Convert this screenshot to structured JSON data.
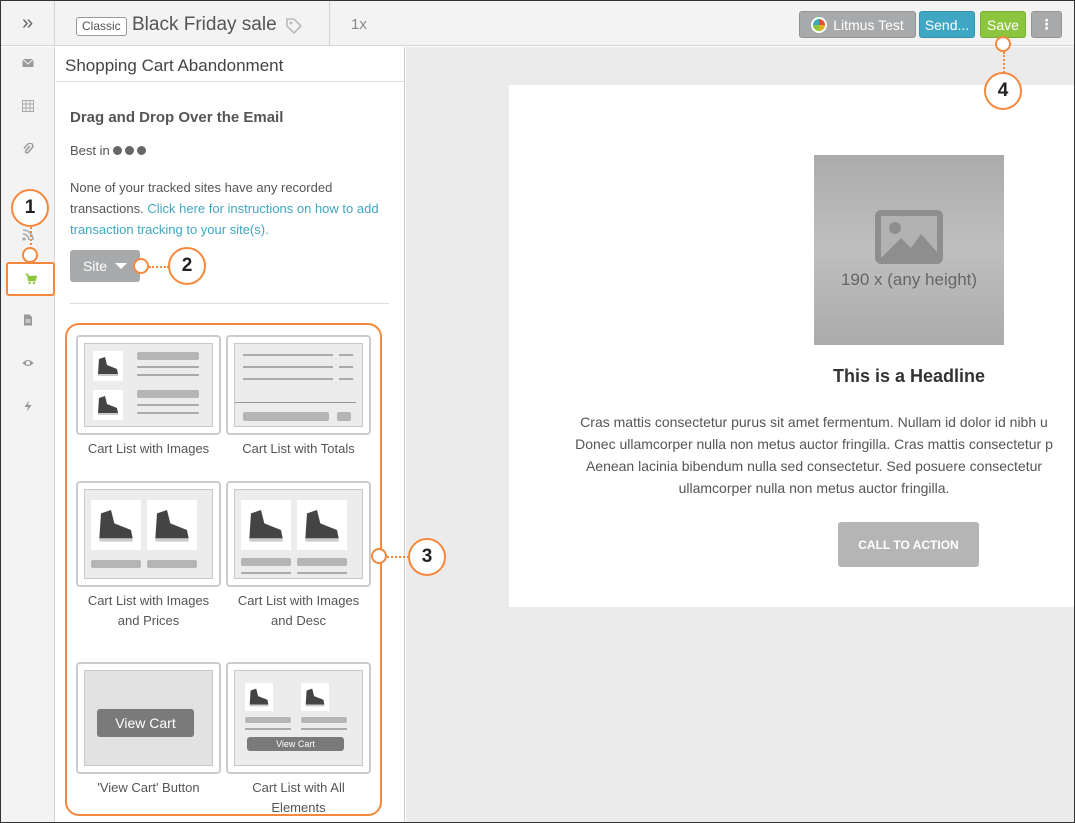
{
  "topbar": {
    "collapse_glyph": "»",
    "badge": "Classic",
    "title": "Black Friday sale",
    "zoom": "1x",
    "buttons": {
      "litmus": "Litmus Test",
      "send": "Send...",
      "save": "Save",
      "more": "⋮"
    }
  },
  "rail": {
    "items": [
      "envelope-icon",
      "grid-icon",
      "paperclip-icon",
      "rss-icon",
      "cart-icon",
      "document-icon",
      "eye-icon",
      "bolt-icon"
    ]
  },
  "panel": {
    "header": "Shopping Cart Abandonment",
    "heading": "Drag and Drop Over the Email",
    "best_in": "Best in",
    "note_text": "None of your tracked sites have any recorded transactions.",
    "note_link": "Click here for instructions on how to add transaction tracking to your site(s).",
    "site_button": "Site",
    "blocks": [
      {
        "label": "Cart List with Images"
      },
      {
        "label": "Cart List with Totals"
      },
      {
        "label": "Cart List with Images and Prices"
      },
      {
        "label": "Cart List with Images and Desc"
      },
      {
        "label": "'View Cart' Button",
        "button_text": "View Cart"
      },
      {
        "label": "Cart List with All Elements",
        "button_text": "View Cart"
      }
    ]
  },
  "email": {
    "image_placeholder": "190 x (any height)",
    "headline": "This is a Headline",
    "body_lines": [
      "Cras mattis consectetur purus sit amet fermentum. Nullam id dolor id nibh u",
      "Donec ullamcorper nulla non metus auctor fringilla. Cras mattis consectetur p",
      "Aenean lacinia bibendum nulla sed consectetur. Sed posuere consectetur",
      "ullamcorper nulla non metus auctor fringilla."
    ],
    "cta": "CALL TO ACTION"
  },
  "callouts": [
    "1",
    "2",
    "3",
    "4"
  ],
  "colors": {
    "accent_orange": "#f5883c",
    "save_green": "#8cc63f",
    "send_blue": "#3fa7c3",
    "neutral_button": "#a7a9ab"
  }
}
